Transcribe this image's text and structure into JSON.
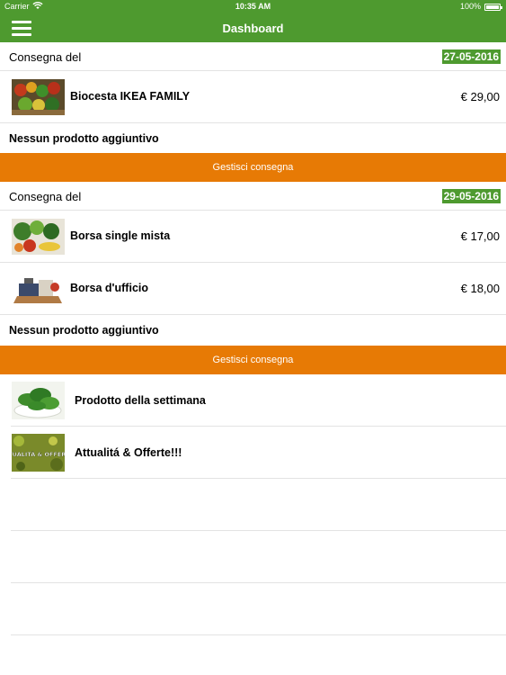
{
  "status_bar": {
    "carrier": "Carrier",
    "time": "10:35 AM",
    "battery": "100%"
  },
  "navbar": {
    "title": "Dashboard",
    "menu_icon": "hamburger-menu-icon"
  },
  "colors": {
    "brand_green": "#4e9a2f",
    "action_orange": "#e77a05",
    "divider": "#e3e3e3"
  },
  "deliveries": [
    {
      "label": "Consegna del",
      "date": "27-05-2016",
      "items": [
        {
          "name": "Biocesta IKEA FAMILY",
          "price": "€ 29,00",
          "image": "vegetable-basket-image"
        }
      ],
      "no_extra": "Nessun prodotto aggiuntivo",
      "manage_label": "Gestisci consegna"
    },
    {
      "label": "Consegna del",
      "date": "29-05-2016",
      "items": [
        {
          "name": "Borsa single mista",
          "price": "€ 17,00",
          "image": "mixed-vegetables-image"
        },
        {
          "name": "Borsa d'ufficio",
          "price": "€ 18,00",
          "image": "office-crate-image"
        }
      ],
      "no_extra": "Nessun prodotto aggiuntivo",
      "manage_label": "Gestisci consegna"
    }
  ],
  "info_items": [
    {
      "name": "Prodotto della settimana",
      "image": "spinach-bowl-image"
    },
    {
      "name": "Attualitá & Offerte!!!",
      "image": "offers-banner-image",
      "image_text": "ATTUALITÀ & OFFERTE!"
    }
  ]
}
